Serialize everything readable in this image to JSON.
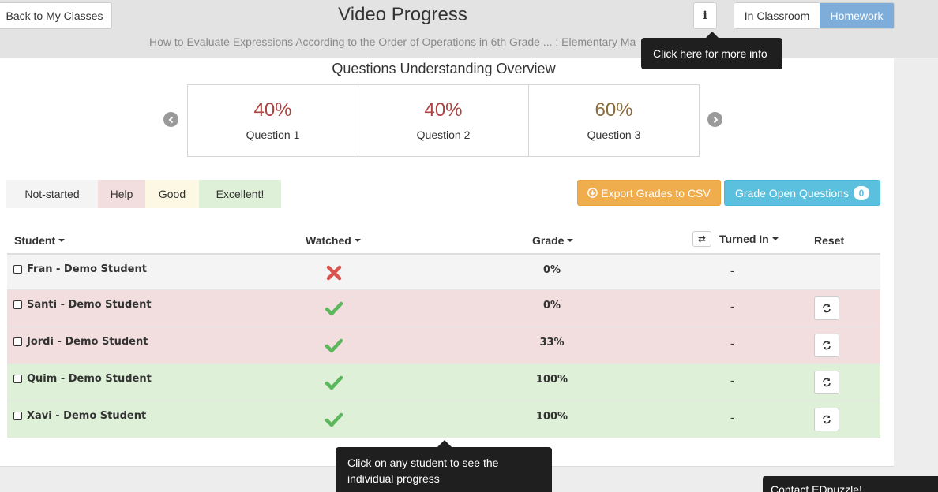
{
  "header": {
    "back_label": "Back to My Classes",
    "title": "Video Progress",
    "subtitle": "How to Evaluate Expressions According to the Order of Operations in 6th Grade ... : Elementary Ma",
    "info_label": "i",
    "modes": {
      "classroom": "In Classroom",
      "homework": "Homework",
      "selected": "homework"
    },
    "info_tooltip": "Click here for more info"
  },
  "overview": {
    "title": "Questions Understanding Overview",
    "questions": [
      {
        "pct": "40%",
        "label": "Question 1",
        "color": "#a94442"
      },
      {
        "pct": "40%",
        "label": "Question 2",
        "color": "#a94442"
      },
      {
        "pct": "60%",
        "label": "Question 3",
        "color": "#8a6d3b"
      }
    ]
  },
  "legend": {
    "not_started": "Not-started",
    "help": "Help",
    "good": "Good",
    "excellent": "Excellent!"
  },
  "actions": {
    "export_label": "Export Grades to CSV",
    "grade_label": "Grade Open Questions",
    "grade_count": "0"
  },
  "table": {
    "headers": {
      "student": "Student",
      "watched": "Watched",
      "grade": "Grade",
      "turned_in": "Turned In",
      "reset": "Reset"
    },
    "rows": [
      {
        "name": "Fran - Demo Student",
        "watched": false,
        "grade": "0%",
        "turned_in": "-",
        "status": "not-started"
      },
      {
        "name": "Santi - Demo Student",
        "watched": true,
        "grade": "0%",
        "turned_in": "-",
        "status": "help"
      },
      {
        "name": "Jordi - Demo Student",
        "watched": true,
        "grade": "33%",
        "turned_in": "-",
        "status": "help"
      },
      {
        "name": "Quim - Demo Student",
        "watched": true,
        "grade": "100%",
        "turned_in": "-",
        "status": "excellent"
      },
      {
        "name": "Xavi - Demo Student",
        "watched": true,
        "grade": "100%",
        "turned_in": "-",
        "status": "excellent"
      }
    ]
  },
  "student_tooltip": "Click on any student to see the individual progress",
  "contact_label": "Contact EDpuzzle!",
  "colors": {
    "check": "#5cb85c",
    "cross": "#d9534f",
    "homework_active": "#7fadd9"
  }
}
